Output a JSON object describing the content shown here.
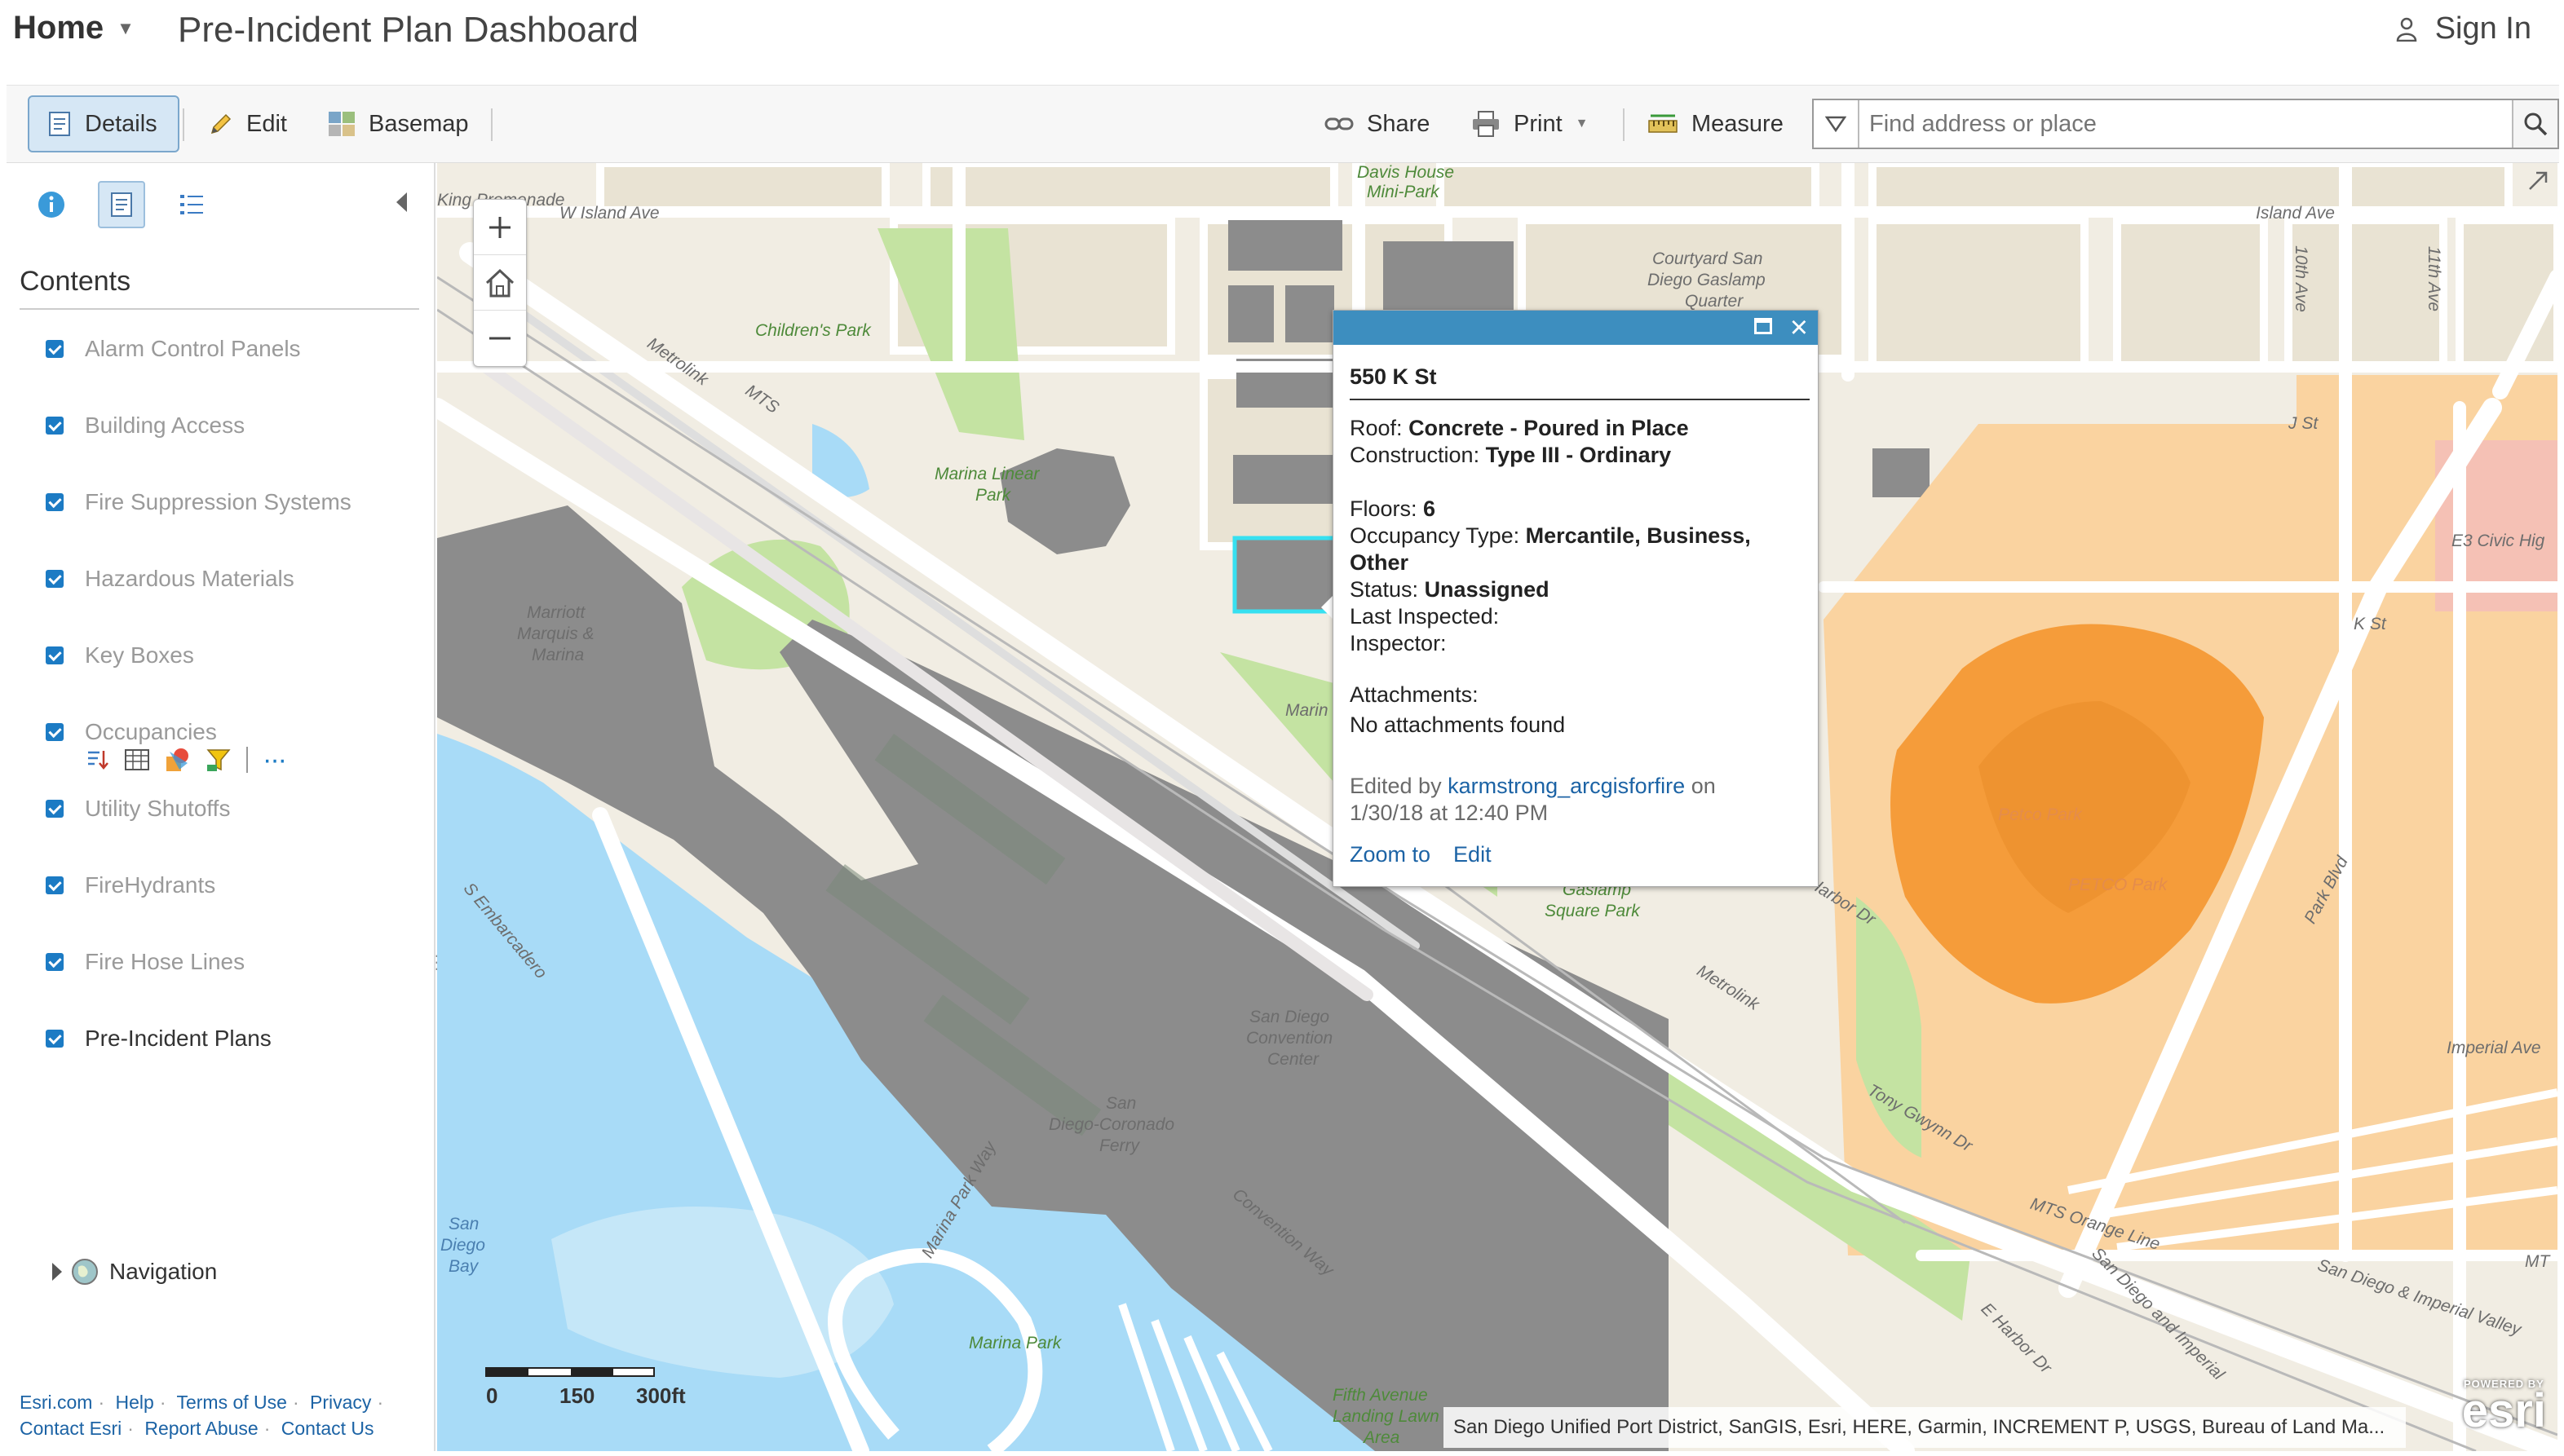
{
  "header": {
    "home_label": "Home",
    "title": "Pre-Incident Plan Dashboard",
    "signin_label": "Sign In"
  },
  "toolbar": {
    "details": "Details",
    "edit": "Edit",
    "basemap": "Basemap",
    "share": "Share",
    "print": "Print",
    "measure": "Measure"
  },
  "search": {
    "placeholder": "Find address or place",
    "value": ""
  },
  "sidebar": {
    "contents_title": "Contents",
    "layers": [
      {
        "label": "Alarm Control Panels",
        "checked": true
      },
      {
        "label": "Building Access",
        "checked": true
      },
      {
        "label": "Fire Suppression Systems",
        "checked": true
      },
      {
        "label": "Hazardous Materials",
        "checked": true
      },
      {
        "label": "Key Boxes",
        "checked": true
      },
      {
        "label": "Occupancies",
        "checked": true
      },
      {
        "label": "Utility Shutoffs",
        "checked": true
      },
      {
        "label": "FireHydrants",
        "checked": true
      },
      {
        "label": "Fire Hose Lines",
        "checked": true
      },
      {
        "label": "Pre-Incident Plans",
        "checked": true
      }
    ],
    "group": "Navigation",
    "footer_links": [
      "Esri.com",
      "Help",
      "Terms of Use",
      "Privacy",
      "Contact Esri",
      "Report Abuse",
      "Contact Us"
    ]
  },
  "popup": {
    "title": "550 K St",
    "roof_label": "Roof:",
    "roof_value": "Concrete - Poured in Place",
    "construction_label": "Construction:",
    "construction_value": "Type III - Ordinary",
    "floors_label": "Floors:",
    "floors_value": "6",
    "occupancy_label": "Occupancy Type:",
    "occupancy_value": "Mercantile, Business, Other",
    "status_label": "Status:",
    "status_value": "Unassigned",
    "last_inspected_label": "Last Inspected:",
    "inspector_label": "Inspector:",
    "attachments_label": "Attachments:",
    "attachments_value": "No attachments found",
    "edited_by_prefix": "Edited by",
    "edited_by_user": "karmstrong_arcgisforfire",
    "edited_on": "on",
    "edited_date": "1/30/18 at 12:40 PM",
    "zoom_to": "Zoom to",
    "edit": "Edit"
  },
  "map": {
    "labels": {
      "island_ave_w": "W Island Ave",
      "island_ave_e": "Island Ave",
      "king_promenade": "King Promenade",
      "davis_house": "Davis House",
      "mini_park": "Mini-Park",
      "courtyard_1": "Courtyard San",
      "courtyard_2": "Diego Gaslamp",
      "courtyard_3": "Quarter",
      "childrens_park": "Children's Park",
      "metrolink": "Metrolink",
      "mts": "MTS",
      "marina_linear_1": "Marina Linear",
      "marina_linear_2": "Park",
      "marriott_1": "Marriott",
      "marriott_2": "Marquis &",
      "marriott_3": "Marina",
      "s_embarcadero": "S Embarcadero",
      "harbor_dr": "Harbor Dr",
      "gaslamp_1": "Gaslamp",
      "gaslamp_2": "Square Park",
      "petco_park_1": "Petco Park",
      "petco_park_2": "PETCO Park",
      "j_st": "J St",
      "k_st": "K St",
      "e3_civic": "E3 Civic Hig",
      "tenth_ave": "10th Ave",
      "eleventh_ave": "11th Ave",
      "park_blvd": "Park Blvd",
      "imperial_ave": "Imperial Ave",
      "tony_gwynn": "Tony Gwynn Dr",
      "convention_1": "San Diego",
      "convention_2": "Convention",
      "convention_3": "Center",
      "ferry_1": "San",
      "ferry_2": "Diego-Coronado",
      "ferry_3": "Ferry",
      "marina_park_way": "Marina Park Way",
      "convention_way": "Convention Way",
      "bay_1": "San",
      "bay_2": "Diego",
      "bay_3": "Bay",
      "marina_park": "Marina Park",
      "fifth_ave_1": "Fifth Avenue",
      "fifth_ave_2": "Landing Lawn",
      "fifth_ave_3": "Area",
      "mts_orange": "MTS Orange Line",
      "sd_imperial": "San Diego & Imperial Valley",
      "e_harbor": "E Harbor Dr",
      "sd_imperial_2": "San Diego and Imperial",
      "marina_park_s": "Marina Park",
      "mt": "MT",
      "mari": "Marin"
    },
    "scale": {
      "zero": "0",
      "mid": "150",
      "end": "300ft"
    },
    "attribution": "San Diego Unified Port District, SanGIS, Esri, HERE, Garmin, INCREMENT P, USGS, Bureau of Land Ma...",
    "esri_powered": "POWERED BY",
    "esri_logo": "esri"
  },
  "colors": {
    "accent": "#3d8ebf",
    "checkbox": "#1c7bc4",
    "link": "#1c63a5",
    "water": "#a8dbf7",
    "park": "#c4e3a2",
    "building": "#8c8c8c",
    "orange": "#f59c3a"
  }
}
